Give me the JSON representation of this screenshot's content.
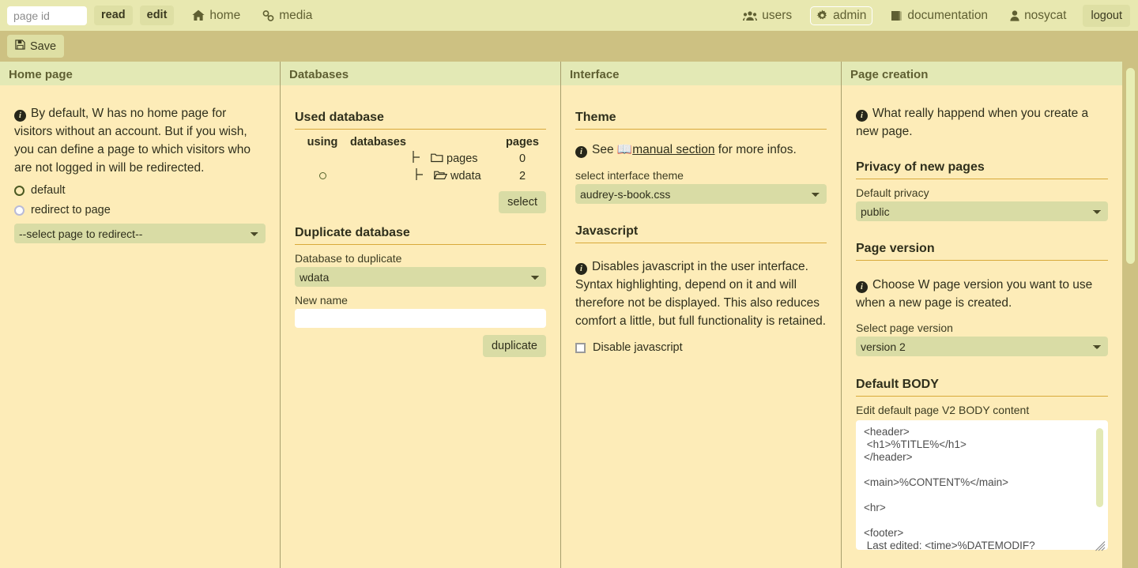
{
  "topbar": {
    "page_id_placeholder": "page id",
    "page_id_value": "",
    "read_label": "read",
    "edit_label": "edit",
    "home_label": "home",
    "media_label": "media",
    "users_label": "users",
    "admin_label": "admin",
    "documentation_label": "documentation",
    "user_label": "nosycat",
    "logout_label": "logout",
    "icons": {
      "home": "home-icon",
      "media": "link-icon",
      "users": "users-icon",
      "admin": "gear-icon",
      "documentation": "book-icon",
      "user": "person-icon"
    },
    "active_item": "admin"
  },
  "toolbar": {
    "save_label": "Save",
    "save_icon": "floppy-disk-icon"
  },
  "columns": {
    "home_page": {
      "title": "Home page",
      "info": "By default, W has no home page for visitors without an account. But if you wish, you can define a page to which visitors who are not logged in will be redirected.",
      "radios": [
        {
          "label": "default",
          "checked": true
        },
        {
          "label": "redirect to page",
          "checked": false
        }
      ],
      "redirect_select_value": "--select page to redirect--"
    },
    "databases": {
      "title": "Databases",
      "used_database": {
        "heading": "Used database",
        "columns": [
          "using",
          "databases",
          "pages"
        ],
        "rows": [
          {
            "name": "pages",
            "pages": "0",
            "using": false,
            "folder": "folder-closed-icon"
          },
          {
            "name": "wdata",
            "pages": "2",
            "using": true,
            "folder": "folder-open-icon"
          }
        ],
        "select_button": "select"
      },
      "duplicate_database": {
        "heading": "Duplicate database",
        "source_label": "Database to duplicate",
        "source_value": "wdata",
        "newname_label": "New name",
        "newname_value": "",
        "duplicate_button": "duplicate"
      }
    },
    "interface": {
      "title": "Interface",
      "theme": {
        "heading": "Theme",
        "info_prefix": "See",
        "info_link": "manual section",
        "info_suffix": "for more infos.",
        "link_icon": "open-book-icon",
        "select_label": "select interface theme",
        "select_value": "audrey-s-book.css"
      },
      "javascript": {
        "heading": "Javascript",
        "info": "Disables javascript in the user interface. Syntax highlighting, depend on it and will therefore not be displayed. This also reduces comfort a little, but full functionality is retained.",
        "checkbox_label": "Disable javascript",
        "checkbox_checked": false
      }
    },
    "page_creation": {
      "title": "Page creation",
      "info": "What really happend when you create a new page.",
      "privacy": {
        "heading": "Privacy of new pages",
        "label": "Default privacy",
        "value": "public"
      },
      "version": {
        "heading": "Page version",
        "info": "Choose W page version you want to use when a new page is created.",
        "label": "Select page version",
        "value": "version 2"
      },
      "default_body": {
        "heading": "Default BODY",
        "label": "Edit default page V2 BODY content",
        "value": "<header>\n <h1>%TITLE%</h1>\n</header>\n\n<main>%CONTENT%</main>\n\n<hr>\n\n<footer>\n Last edited: <time>%DATEMODIF?"
      }
    }
  },
  "colors": {
    "topbar_bg": "#e8e8b0",
    "toolbar_bg": "#cdc182",
    "panel_bg": "#fdecb8",
    "panel_head_bg": "#e3e9b5",
    "control_bg": "#d9dca5",
    "rule": "#d8a93a",
    "text": "#2f2f1c"
  }
}
